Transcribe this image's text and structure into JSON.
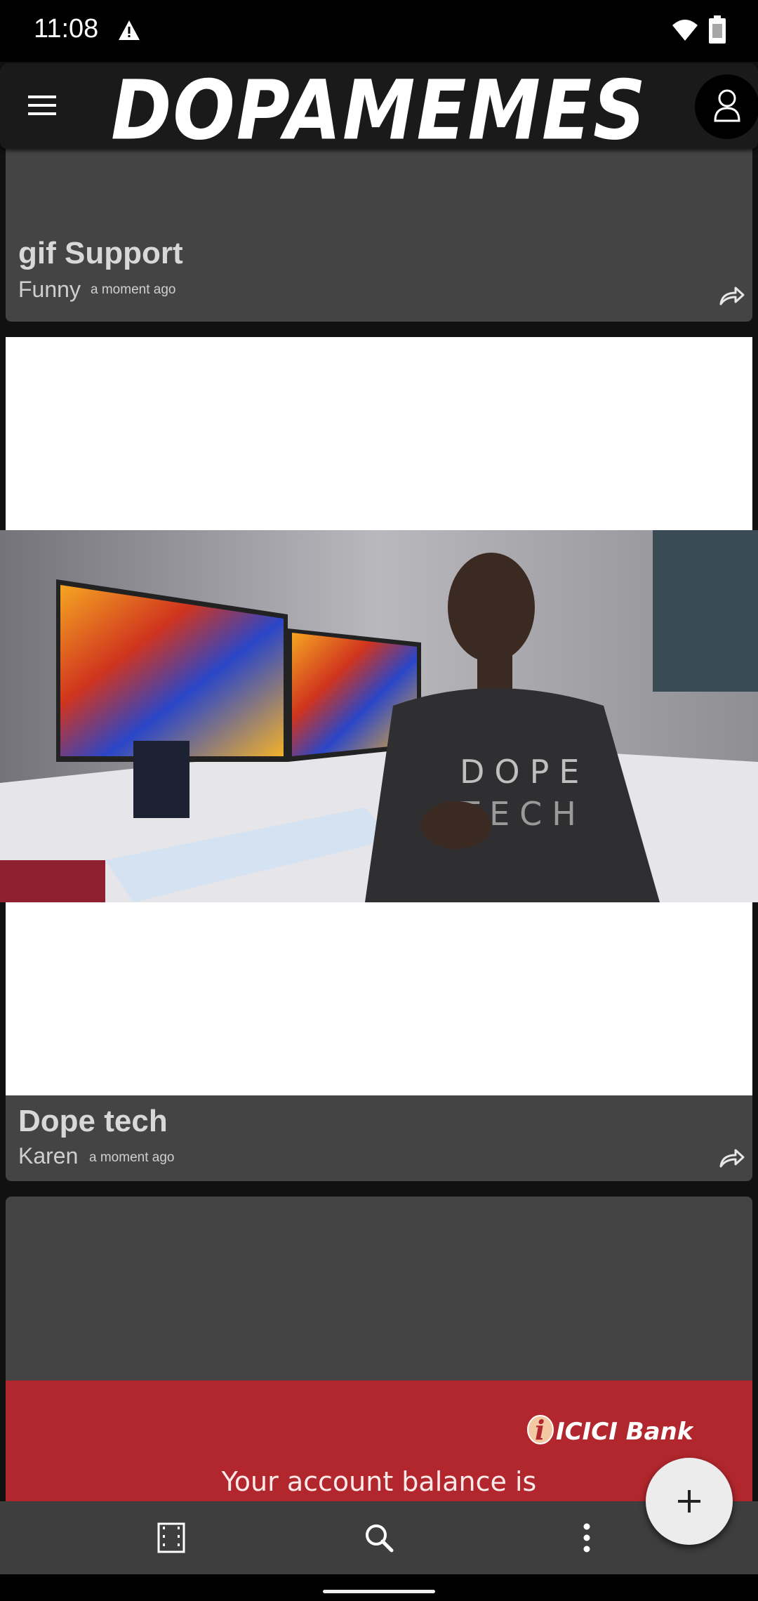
{
  "status": {
    "time": "11:08"
  },
  "header": {
    "logo": "DOPAMEMES"
  },
  "posts": [
    {
      "title": "gif Support",
      "author": "Funny",
      "time": "a moment ago"
    },
    {
      "title": "Dope tech",
      "author": "Karen",
      "time": "a moment ago"
    }
  ],
  "ad": {
    "brand": "ICICI Bank",
    "text": "Your account balance is"
  },
  "colors": {
    "card": "#444444",
    "header": "#1a1a1a",
    "ad": "#b2272d",
    "bottom_bar": "#3e3e3e"
  },
  "icons": [
    "menu-icon",
    "account-icon",
    "share-icon",
    "film-icon",
    "search-icon",
    "more-vert-icon",
    "plus-icon"
  ]
}
